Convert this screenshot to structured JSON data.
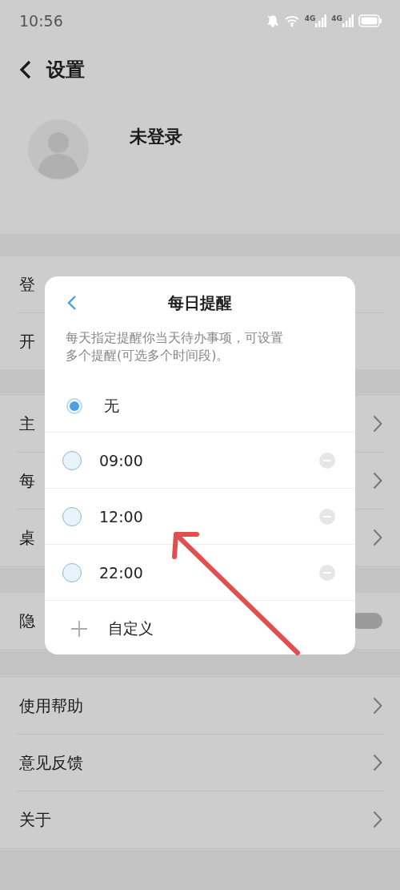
{
  "status_bar": {
    "time": "10:56",
    "networks": [
      "4G",
      "4G"
    ]
  },
  "header": {
    "title": "设置"
  },
  "profile": {
    "name": "未登录"
  },
  "sections": [
    {
      "rows": [
        {
          "label": "登",
          "kind": "plain"
        },
        {
          "label": "开",
          "kind": "plain"
        }
      ]
    },
    {
      "rows": [
        {
          "label": "主",
          "kind": "link"
        },
        {
          "label": "每",
          "kind": "link"
        },
        {
          "label": "桌",
          "kind": "link"
        }
      ]
    },
    {
      "rows": [
        {
          "label": "隐",
          "kind": "toggle",
          "on": false
        }
      ]
    },
    {
      "rows": [
        {
          "label": "使用帮助",
          "kind": "link"
        },
        {
          "label": "意见反馈",
          "kind": "link"
        },
        {
          "label": "关于",
          "kind": "link"
        }
      ]
    }
  ],
  "dialog": {
    "title": "每日提醒",
    "description": "每天指定提醒你当天待办事项，可设置多个提醒(可选多个时间段)。",
    "options": [
      {
        "label": "无",
        "kind": "none",
        "selected": true
      },
      {
        "label": "09:00",
        "kind": "time",
        "selected": false
      },
      {
        "label": "12:00",
        "kind": "time",
        "selected": false
      },
      {
        "label": "22:00",
        "kind": "time",
        "selected": false
      }
    ],
    "add": {
      "label": "自定义"
    }
  }
}
